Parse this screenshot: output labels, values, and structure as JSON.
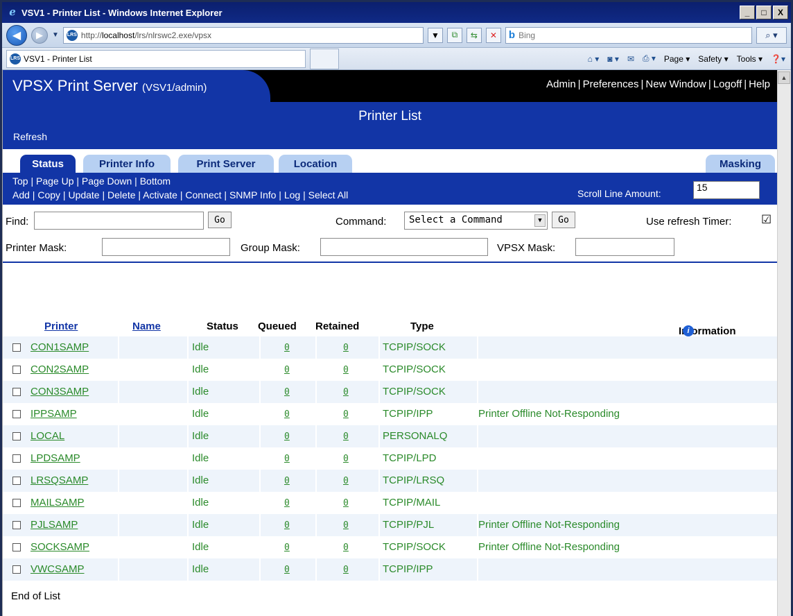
{
  "window": {
    "title": "VSV1 - Printer List - Windows Internet Explorer",
    "minimize": "_",
    "maximize": "□",
    "close": "X"
  },
  "browser": {
    "url_prefix": "http://",
    "url_host": "localhost",
    "url_path": "/lrs/nlrswc2.exe/vpsx",
    "site_icon_text": "LRS",
    "search_placeholder": "Bing",
    "tab_title": "VSV1 - Printer List",
    "cmd_page": "Page ▾",
    "cmd_safety": "Safety ▾",
    "cmd_tools": "Tools ▾"
  },
  "header": {
    "brand": "VPSX Print Server",
    "brand_sub": "(VSV1/admin)",
    "links": [
      "Admin",
      "Preferences",
      "New Window",
      "Logoff",
      "Help"
    ],
    "page_title": "Printer List",
    "refresh": "Refresh"
  },
  "tabs": {
    "status": "Status",
    "printer_info": "Printer Info",
    "print_server": "Print Server",
    "location": "Location",
    "masking": "Masking"
  },
  "nav": {
    "row1": [
      "Top",
      "Page Up",
      "Page Down",
      "Bottom"
    ],
    "row2": [
      "Add",
      "Copy",
      "Update",
      "Delete",
      "Activate",
      "Connect",
      "SNMP Info",
      "Log",
      "Select All"
    ],
    "scroll_label": "Scroll Line Amount:",
    "scroll_value": "15"
  },
  "controls": {
    "find_label": "Find:",
    "go": "Go",
    "command_label": "Command:",
    "command_selected": "Select a Command",
    "refresh_timer_label": "Use refresh Timer:",
    "refresh_timer_checked": "☑",
    "printer_mask_label": "Printer Mask:",
    "group_mask_label": "Group Mask:",
    "vpsx_mask_label": "VPSX Mask:"
  },
  "table": {
    "headers": {
      "printer": "Printer",
      "name": "Name",
      "status": "Status",
      "queued": "Queued",
      "retained": "Retained",
      "type": "Type",
      "information": "Information"
    },
    "info_icon": "i",
    "rows": [
      {
        "printer": "CON1SAMP",
        "status": "Idle",
        "queued": "0",
        "retained": "0",
        "type": "TCPIP/SOCK",
        "info": ""
      },
      {
        "printer": "CON2SAMP",
        "status": "Idle",
        "queued": "0",
        "retained": "0",
        "type": "TCPIP/SOCK",
        "info": ""
      },
      {
        "printer": "CON3SAMP",
        "status": "Idle",
        "queued": "0",
        "retained": "0",
        "type": "TCPIP/SOCK",
        "info": ""
      },
      {
        "printer": "IPPSAMP",
        "status": "Idle",
        "queued": "0",
        "retained": "0",
        "type": "TCPIP/IPP",
        "info": "Printer Offline Not-Responding"
      },
      {
        "printer": "LOCAL",
        "status": "Idle",
        "queued": "0",
        "retained": "0",
        "type": "PERSONALQ",
        "info": ""
      },
      {
        "printer": "LPDSAMP",
        "status": "Idle",
        "queued": "0",
        "retained": "0",
        "type": "TCPIP/LPD",
        "info": ""
      },
      {
        "printer": "LRSQSAMP",
        "status": "Idle",
        "queued": "0",
        "retained": "0",
        "type": "TCPIP/LRSQ",
        "info": ""
      },
      {
        "printer": "MAILSAMP",
        "status": "Idle",
        "queued": "0",
        "retained": "0",
        "type": "TCPIP/MAIL",
        "info": ""
      },
      {
        "printer": "PJLSAMP",
        "status": "Idle",
        "queued": "0",
        "retained": "0",
        "type": "TCPIP/PJL",
        "info": "Printer Offline Not-Responding"
      },
      {
        "printer": "SOCKSAMP",
        "status": "Idle",
        "queued": "0",
        "retained": "0",
        "type": "TCPIP/SOCK",
        "info": "Printer Offline Not-Responding"
      },
      {
        "printer": "VWCSAMP",
        "status": "Idle",
        "queued": "0",
        "retained": "0",
        "type": "TCPIP/IPP",
        "info": ""
      }
    ],
    "end_of_list": "End of List"
  },
  "colors": {
    "brand_blue": "#1235a6",
    "tab_light": "#b7d0f2",
    "row_green": "#2a8a2a"
  }
}
